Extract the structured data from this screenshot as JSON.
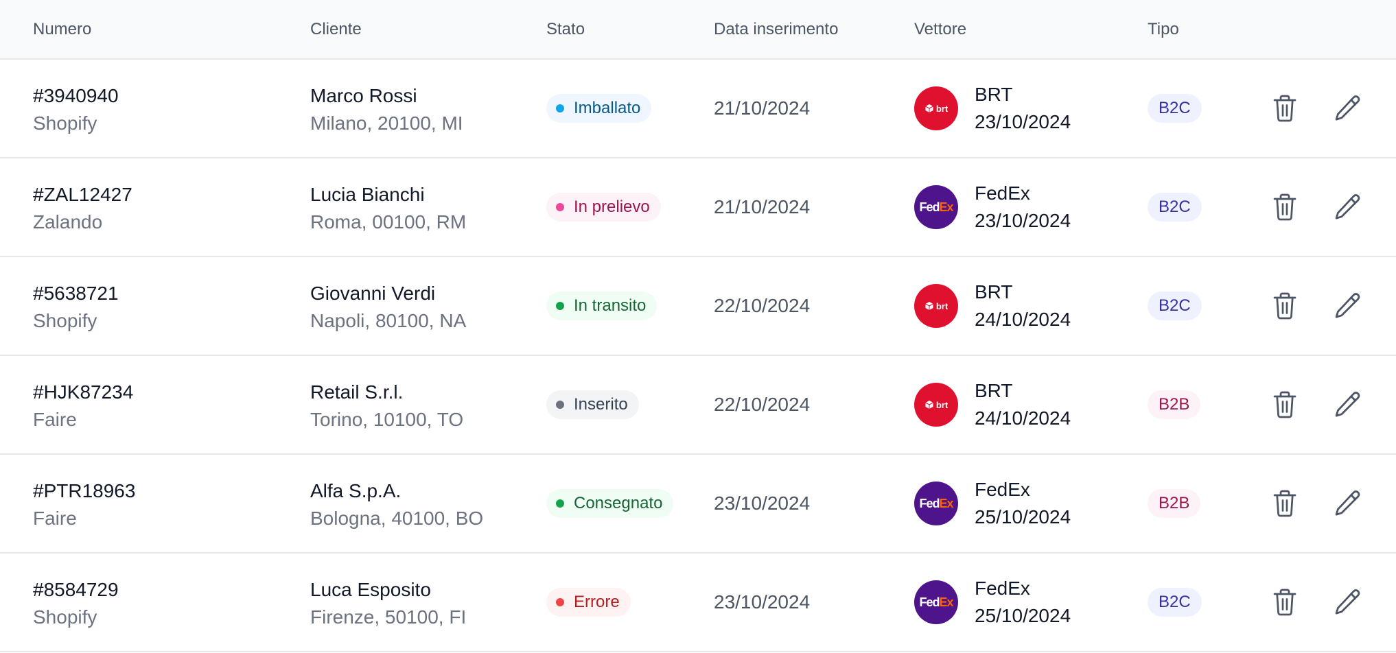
{
  "headers": {
    "numero": "Numero",
    "cliente": "Cliente",
    "stato": "Stato",
    "data": "Data inserimento",
    "vettore": "Vettore",
    "tipo": "Tipo"
  },
  "colors": {
    "imballato": {
      "bg": "#eff6ff",
      "dot": "#0ea5e9",
      "text": "#075985"
    },
    "prelievo": {
      "bg": "#fdf2f8",
      "dot": "#ec4899",
      "text": "#9d174d"
    },
    "transito": {
      "bg": "#f0fdf4",
      "dot": "#16a34a",
      "text": "#166534"
    },
    "inserito": {
      "bg": "#f3f4f6",
      "dot": "#6b7280",
      "text": "#374151"
    },
    "consegnato": {
      "bg": "#f0fdf4",
      "dot": "#16a34a",
      "text": "#166534"
    },
    "errore": {
      "bg": "#fef2f2",
      "dot": "#ef4444",
      "text": "#b91c1c"
    },
    "b2c": {
      "bg": "#eef2ff",
      "text": "#3730a3"
    },
    "b2b": {
      "bg": "#fdf2f8",
      "text": "#9d174d"
    }
  },
  "rows": [
    {
      "numero": "#3940940",
      "source": "Shopify",
      "cliente": "Marco Rossi",
      "indirizzo": "Milano, 20100, MI",
      "stato": "Imballato",
      "stato_key": "imballato",
      "data": "21/10/2024",
      "vettore": "BRT",
      "vettore_key": "brt",
      "consegna": "23/10/2024",
      "tipo": "B2C",
      "tipo_key": "b2c"
    },
    {
      "numero": "#ZAL12427",
      "source": "Zalando",
      "cliente": "Lucia Bianchi",
      "indirizzo": "Roma, 00100, RM",
      "stato": "In prelievo",
      "stato_key": "prelievo",
      "data": "21/10/2024",
      "vettore": "FedEx",
      "vettore_key": "fedex",
      "consegna": "23/10/2024",
      "tipo": "B2C",
      "tipo_key": "b2c"
    },
    {
      "numero": "#5638721",
      "source": "Shopify",
      "cliente": "Giovanni Verdi",
      "indirizzo": "Napoli, 80100, NA",
      "stato": "In transito",
      "stato_key": "transito",
      "data": "22/10/2024",
      "vettore": "BRT",
      "vettore_key": "brt",
      "consegna": "24/10/2024",
      "tipo": "B2C",
      "tipo_key": "b2c"
    },
    {
      "numero": "#HJK87234",
      "source": "Faire",
      "cliente": "Retail S.r.l.",
      "indirizzo": "Torino, 10100, TO",
      "stato": "Inserito",
      "stato_key": "inserito",
      "data": "22/10/2024",
      "vettore": "BRT",
      "vettore_key": "brt",
      "consegna": "24/10/2024",
      "tipo": "B2B",
      "tipo_key": "b2b"
    },
    {
      "numero": "#PTR18963",
      "source": "Faire",
      "cliente": "Alfa S.p.A.",
      "indirizzo": "Bologna, 40100, BO",
      "stato": "Consegnato",
      "stato_key": "consegnato",
      "data": "23/10/2024",
      "vettore": "FedEx",
      "vettore_key": "fedex",
      "consegna": "25/10/2024",
      "tipo": "B2B",
      "tipo_key": "b2b"
    },
    {
      "numero": "#8584729",
      "source": "Shopify",
      "cliente": "Luca Esposito",
      "indirizzo": "Firenze, 50100, FI",
      "stato": "Errore",
      "stato_key": "errore",
      "data": "23/10/2024",
      "vettore": "FedEx",
      "vettore_key": "fedex",
      "consegna": "25/10/2024",
      "tipo": "B2C",
      "tipo_key": "b2c"
    }
  ],
  "logos": {
    "brt": {
      "icon": "brt-logo-icon",
      "text": "brt"
    },
    "fedex": {
      "icon": "fedex-logo-icon",
      "fe": "Fed",
      "ex": "Ex"
    }
  },
  "icons": {
    "delete": "trash-icon",
    "edit": "pencil-icon"
  }
}
